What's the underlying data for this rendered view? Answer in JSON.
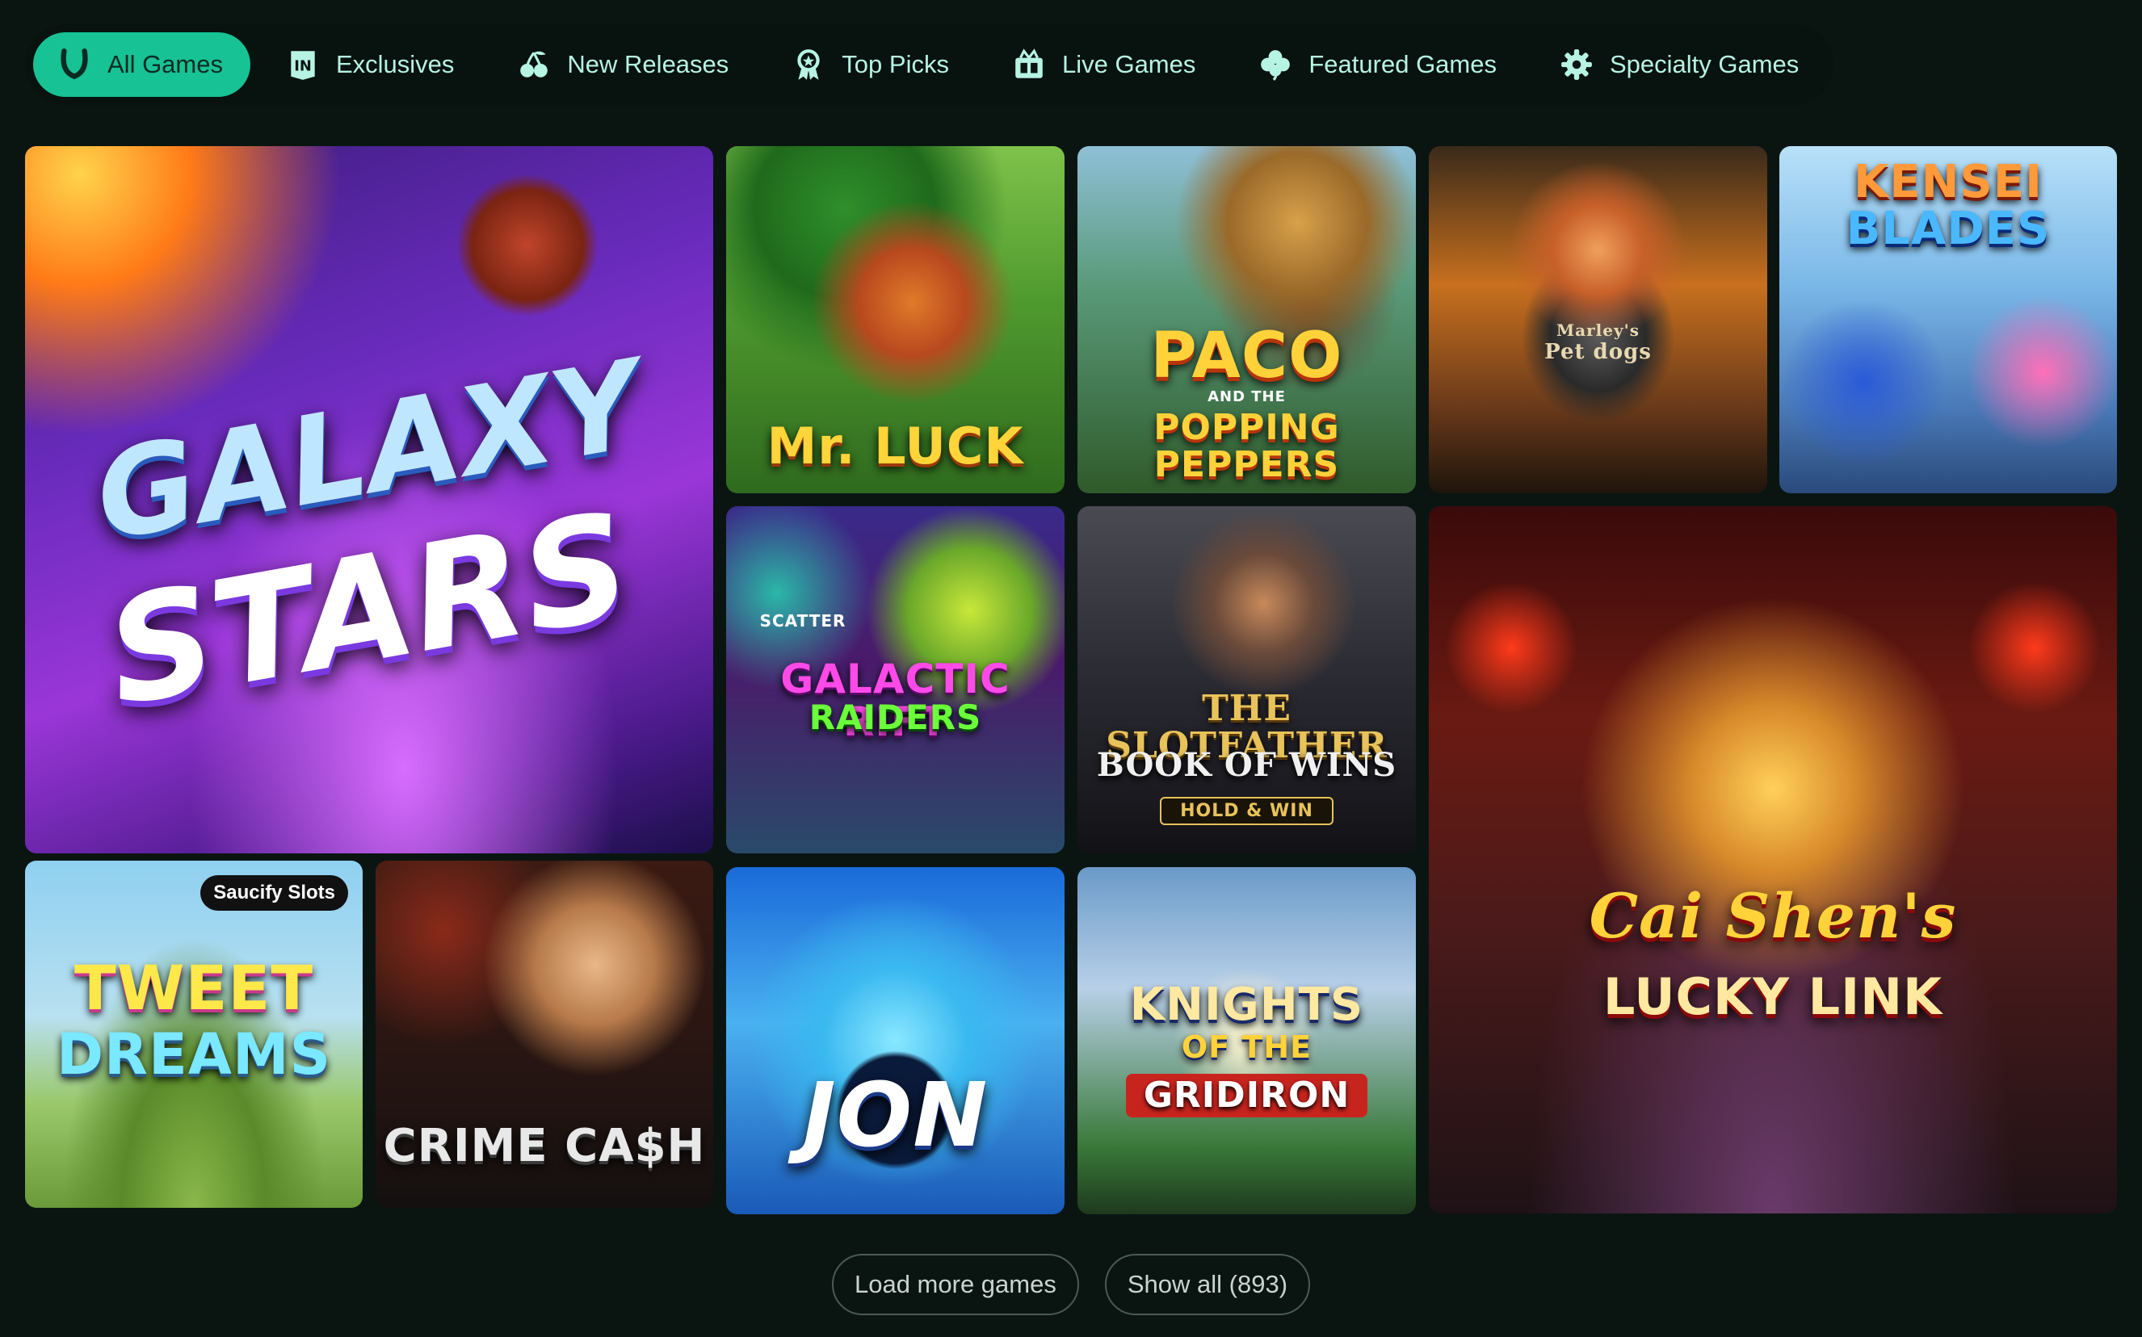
{
  "tabs": [
    {
      "label": "All Games",
      "icon": "horseshoe-icon",
      "active": true
    },
    {
      "label": "Exclusives",
      "icon": "exclusive-badge-icon"
    },
    {
      "label": "New Releases",
      "icon": "cherries-icon"
    },
    {
      "label": "Top Picks",
      "icon": "award-ribbon-icon"
    },
    {
      "label": "Live Games",
      "icon": "live-dealer-icon"
    },
    {
      "label": "Featured Games",
      "icon": "clover-icon"
    },
    {
      "label": "Specialty Games",
      "icon": "gear-icon"
    }
  ],
  "games": {
    "galaxy_stars": {
      "line1": "GALAXY",
      "line2": "STARS"
    },
    "mr_luck": {
      "title": "Mr. LUCK"
    },
    "paco": {
      "line1": "PACO",
      "line2": "AND THE",
      "line3": "POPPING PEPPERS"
    },
    "marleys": {
      "line1": "Marley's",
      "line2": "Pet dogs"
    },
    "kensei": {
      "line1": "KENSEI",
      "line2": "BLADES"
    },
    "galactic": {
      "scatter": "SCATTER",
      "line1": "GALACTIC RIFT",
      "line2": "RAIDERS"
    },
    "slotfather": {
      "line1": "THE SLOTFATHER",
      "line2": "BOOK OF WINS",
      "line3": "HOLD & WIN"
    },
    "caishen": {
      "line1": "Cai Shen's",
      "line2": "LUCKY LINK"
    },
    "tweet": {
      "badge": "Saucify Slots",
      "line1": "TWEET",
      "line2": "DREAMS"
    },
    "crime": {
      "title": "CRIME CA$H"
    },
    "jon": {
      "title": "JON"
    },
    "knights": {
      "line1": "KNIGHTS",
      "line2": "OF THE",
      "line3": "GRIDIRON"
    }
  },
  "buttons": {
    "load_more": "Load more games",
    "show_all": "Show all (893)"
  }
}
